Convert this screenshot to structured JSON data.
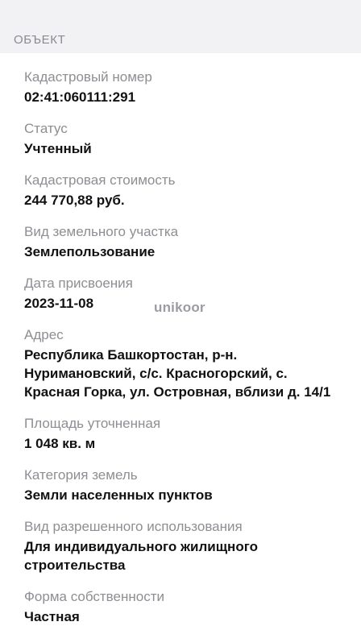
{
  "section": {
    "title": "ОБЪЕКТ"
  },
  "fields": [
    {
      "label": "Кадастровый номер",
      "value": "02:41:060111:291"
    },
    {
      "label": "Статус",
      "value": "Учтенный"
    },
    {
      "label": "Кадастровая стоимость",
      "value": "244 770,88 руб."
    },
    {
      "label": "Вид земельного участка",
      "value": "Землепользование"
    },
    {
      "label": "Дата присвоения",
      "value": "2023-11-08"
    },
    {
      "label": "Адрес",
      "value": "Республика Башкортостан, р-н. Нуримановский, с/с. Красногорский, с. Красная Горка, ул. Островная, вблизи д. 14/1"
    },
    {
      "label": "Площадь уточненная",
      "value": "1 048 кв. м"
    },
    {
      "label": "Категория земель",
      "value": "Земли населенных пунктов"
    },
    {
      "label": "Вид разрешенного использования",
      "value": "Для индивидуального жилищного строительства"
    },
    {
      "label": "Форма собственности",
      "value": "Частная"
    }
  ],
  "watermark": {
    "text": "unikoor"
  }
}
